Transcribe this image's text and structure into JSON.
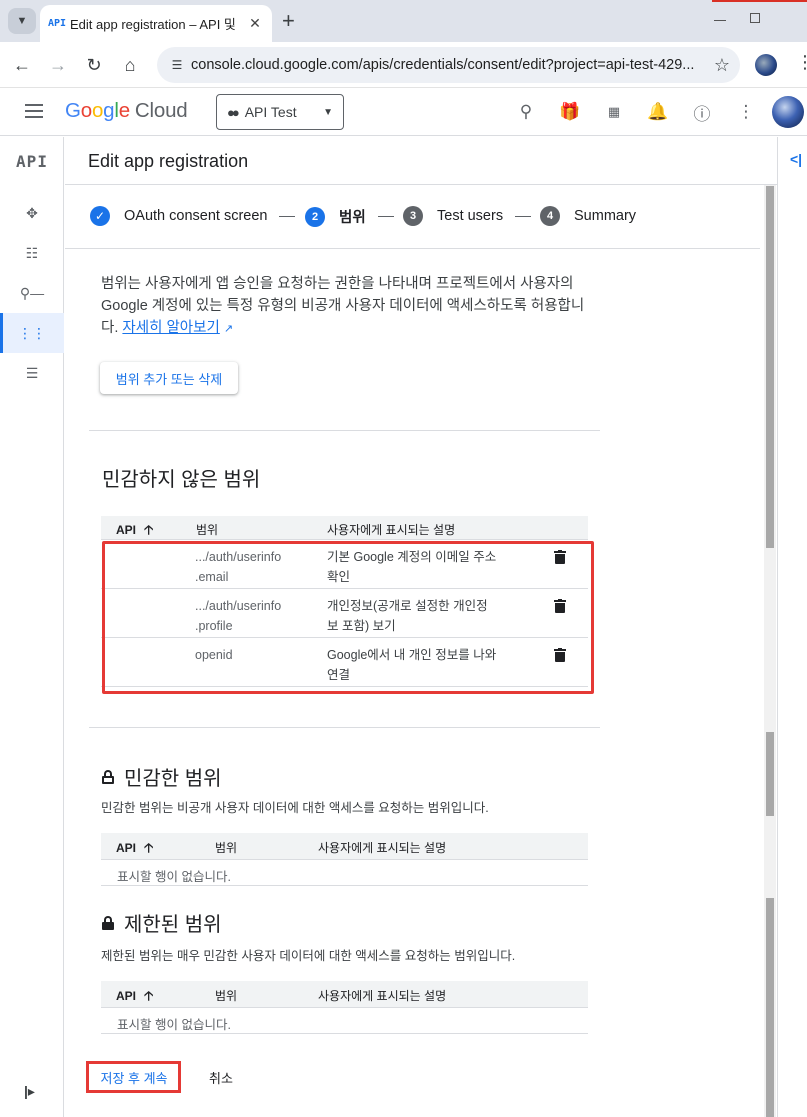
{
  "browser": {
    "tab_favicon": "API",
    "tab_title": "Edit app registration – API 및",
    "url": "console.cloud.google.com/apis/credentials/consent/edit?project=api-test-429...",
    "icons": [
      "tab-search-icon",
      "close-icon",
      "new-tab-icon",
      "back-icon",
      "forward-icon",
      "reload-icon",
      "home-icon",
      "site-info-icon",
      "bookmark-star-icon",
      "profile-avatar",
      "kebab-menu-icon"
    ]
  },
  "header": {
    "logo_google": [
      "G",
      "o",
      "o",
      "g",
      "l",
      "e"
    ],
    "logo_cloud": "Cloud",
    "project_name": "API Test",
    "icons": [
      "search-icon",
      "gift-icon",
      "cloud-shell-icon",
      "notifications-icon",
      "help-icon",
      "more-vert-icon"
    ]
  },
  "rail": {
    "product_label": "API",
    "items": [
      "dashboard-icon",
      "library-icon",
      "credentials-key-icon",
      "oauth-consent-icon",
      "page-usage-icon"
    ],
    "active_index": 3
  },
  "page": {
    "title": "Edit app registration"
  },
  "stepper": {
    "steps": [
      {
        "number": "✓",
        "label": "OAuth consent screen",
        "state": "done"
      },
      {
        "number": "2",
        "label": "범위",
        "state": "current"
      },
      {
        "number": "3",
        "label": "Test users",
        "state": "pending"
      },
      {
        "number": "4",
        "label": "Summary",
        "state": "pending"
      }
    ]
  },
  "scopes": {
    "intro_text": "범위는 사용자에게 앱 승인을 요청하는 권한을 나타내며 프로젝트에서 사용자의 Google 계정에 있는 특정 유형의 비공개 사용자 데이터에 액세스하도록 허용합니다.",
    "learn_more": "자세히 알아보기",
    "add_remove_button": "범위 추가 또는 삭제",
    "non_sensitive": {
      "title": "민감하지 않은 범위",
      "columns": [
        "API",
        "범위",
        "사용자에게 표시되는 설명"
      ],
      "rows": [
        {
          "api": "",
          "scope_line1": ".../auth/userinfo",
          "scope_line2": ".email",
          "desc_line1": "기본 Google 계정의 이메일 주소",
          "desc_line2": "확인"
        },
        {
          "api": "",
          "scope_line1": ".../auth/userinfo",
          "scope_line2": ".profile",
          "desc_line1": "개인정보(공개로 설정한 개인정",
          "desc_line2": "보 포함) 보기"
        },
        {
          "api": "",
          "scope_line1": "openid",
          "scope_line2": "",
          "desc_line1": "Google에서 내 개인 정보를 나와",
          "desc_line2": "연결"
        }
      ]
    },
    "sensitive": {
      "title": "민감한 범위",
      "description": "민감한 범위는 비공개 사용자 데이터에 대한 액세스를 요청하는 범위입니다.",
      "columns": [
        "API",
        "범위",
        "사용자에게 표시되는 설명"
      ],
      "empty": "표시할 행이 없습니다."
    },
    "restricted": {
      "title": "제한된 범위",
      "description": "제한된 범위는 매우 민감한 사용자 데이터에 대한 액세스를 요청하는 범위입니다.",
      "columns": [
        "API",
        "범위",
        "사용자에게 표시되는 설명"
      ],
      "empty": "표시할 행이 없습니다."
    }
  },
  "actions": {
    "save_continue": "저장 후 계속",
    "cancel": "취소"
  },
  "colors": {
    "accent": "#1a73e8",
    "highlight": "#e53935"
  }
}
